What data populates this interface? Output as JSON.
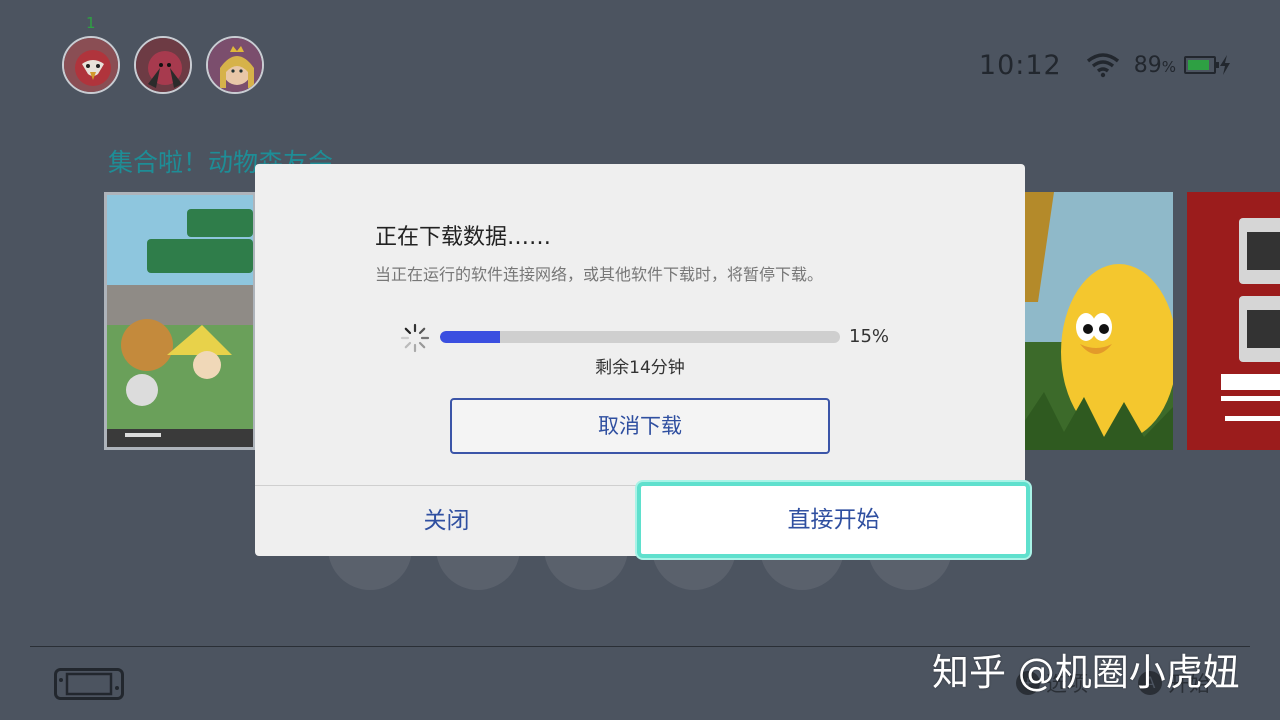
{
  "home": {
    "user_badge": "1",
    "status": {
      "time": "10:12",
      "battery_percent": "89",
      "battery_percent_sign": "%",
      "battery_level": 0.89
    },
    "game_title": "集合啦！动物森友会",
    "hints": {
      "options_key": "+",
      "options_label": "选项",
      "start_key": "A",
      "start_label": "开始"
    }
  },
  "dialog": {
    "title": "正在下载数据……",
    "description": "当正在运行的软件连接网络，或其他软件下载时，将暂停下载。",
    "progress_fraction": 0.15,
    "progress_label": "15%",
    "remaining": "剩余14分钟",
    "cancel_label": "取消下载",
    "close_label": "关闭",
    "start_label": "直接开始"
  },
  "watermark": "知乎 @机圈小虎妞",
  "colors": {
    "accent_blue": "#2f4fa0",
    "progress_fill": "#3b4fe0",
    "focus_ring": "#5fe0cd",
    "battery_green": "#2ea043"
  },
  "icons": [
    "wifi-icon",
    "battery-icon",
    "charging-bolt-icon",
    "loading-spinner-icon",
    "console-icon",
    "plus-button-icon",
    "a-button-icon"
  ]
}
